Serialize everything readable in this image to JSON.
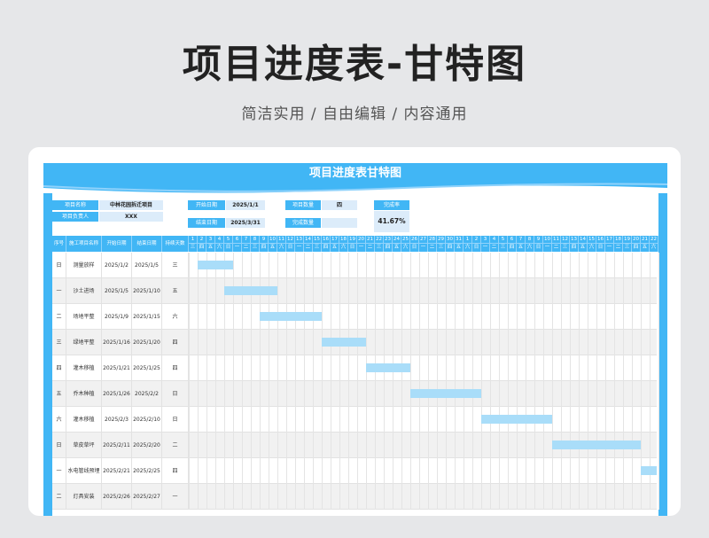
{
  "page": {
    "title": "项目进度表-甘特图",
    "subtitle": "简洁实用 / 自由编辑 / 内容通用"
  },
  "sheet": {
    "title": "项目进度表甘特图",
    "info": {
      "project_name_label": "项目名称",
      "project_name": "中林花园拆迁项目",
      "owner_label": "项目负责人",
      "owner": "XXX",
      "start_label": "开始日期",
      "start": "2025/1/1",
      "end_label": "结束日期",
      "end": "2025/3/31",
      "count_label": "项目数量",
      "count": "四",
      "done_label": "完成数量",
      "done": "",
      "rate_label": "完成率",
      "rate": "41.67%"
    },
    "headers": {
      "seq": "序号",
      "task": "施工项目名称",
      "start": "开始日期",
      "end": "结束日期",
      "days": "持续天数"
    },
    "day_numbers": [
      "1",
      "2",
      "3",
      "4",
      "5",
      "6",
      "7",
      "8",
      "9",
      "10",
      "11",
      "12",
      "13",
      "14",
      "15",
      "16",
      "17",
      "18",
      "19",
      "20",
      "21",
      "22",
      "23",
      "24",
      "25",
      "26",
      "27",
      "28",
      "29",
      "30",
      "31",
      "1",
      "2",
      "3",
      "4",
      "5",
      "6",
      "7",
      "8",
      "9",
      "10",
      "11",
      "12",
      "13",
      "14",
      "15",
      "16",
      "17",
      "18",
      "19",
      "20",
      "21",
      "22"
    ],
    "weekdays": [
      "三",
      "四",
      "五",
      "六",
      "日",
      "一",
      "二",
      "三",
      "四",
      "五",
      "六",
      "日",
      "一",
      "二",
      "三",
      "四",
      "五",
      "六",
      "日",
      "一",
      "二",
      "三",
      "四",
      "五",
      "六",
      "日",
      "一",
      "二",
      "三",
      "四",
      "五",
      "六",
      "日",
      "一",
      "二",
      "三",
      "四",
      "五",
      "六",
      "日",
      "一",
      "二",
      "三",
      "四",
      "五",
      "六",
      "日",
      "一",
      "二",
      "三",
      "四",
      "五",
      "六"
    ],
    "rows": [
      {
        "seq": "日",
        "task": "测量放样",
        "start": "2025/1/2",
        "end": "2025/1/5",
        "days": "三",
        "bar_start": 1,
        "bar_len": 4
      },
      {
        "seq": "一",
        "task": "沙土进场",
        "start": "2025/1/5",
        "end": "2025/1/10",
        "days": "五",
        "bar_start": 4,
        "bar_len": 6
      },
      {
        "seq": "二",
        "task": "场地平整",
        "start": "2025/1/9",
        "end": "2025/1/15",
        "days": "六",
        "bar_start": 8,
        "bar_len": 7
      },
      {
        "seq": "三",
        "task": "绿地平整",
        "start": "2025/1/16",
        "end": "2025/1/20",
        "days": "四",
        "bar_start": 15,
        "bar_len": 5
      },
      {
        "seq": "四",
        "task": "灌木移植",
        "start": "2025/1/21",
        "end": "2025/1/25",
        "days": "四",
        "bar_start": 20,
        "bar_len": 5
      },
      {
        "seq": "五",
        "task": "乔木种植",
        "start": "2025/1/26",
        "end": "2025/2/2",
        "days": "日",
        "bar_start": 25,
        "bar_len": 8
      },
      {
        "seq": "六",
        "task": "灌木移植",
        "start": "2025/2/3",
        "end": "2025/2/10",
        "days": "日",
        "bar_start": 33,
        "bar_len": 8
      },
      {
        "seq": "日",
        "task": "草皮草坪",
        "start": "2025/2/11",
        "end": "2025/2/20",
        "days": "二",
        "bar_start": 41,
        "bar_len": 10
      },
      {
        "seq": "一",
        "task": "水电管线预埋",
        "start": "2025/2/21",
        "end": "2025/2/25",
        "days": "四",
        "bar_start": 51,
        "bar_len": 5
      },
      {
        "seq": "二",
        "task": "灯具安装",
        "start": "2025/2/26",
        "end": "2025/2/27",
        "days": "一",
        "bar_start": 56,
        "bar_len": 0
      }
    ]
  },
  "colors": {
    "accent": "#41b6f5",
    "bar": "#a9ddf9",
    "info_value_bg": "#dcecfa"
  }
}
